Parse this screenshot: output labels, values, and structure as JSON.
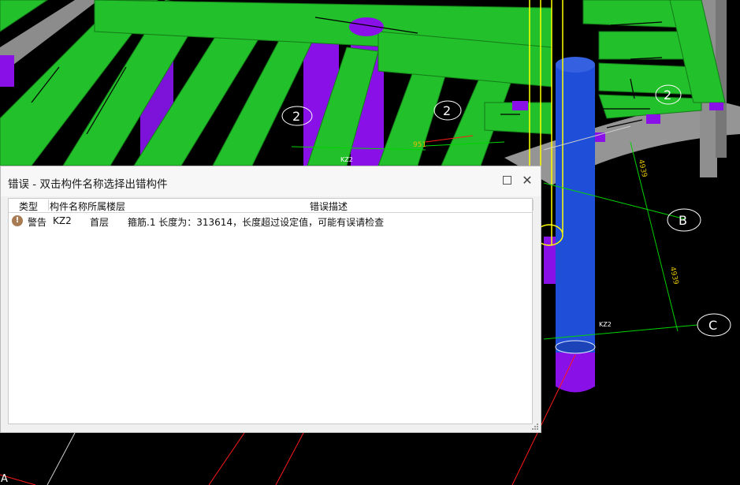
{
  "dialog": {
    "title": "错误 - 双击构件名称选择出错构件",
    "columns": {
      "type": "类型",
      "name_floor": "构件名称所属楼层",
      "description": "错误描述"
    },
    "rows": [
      {
        "type": "警告",
        "name": "KZ2",
        "floor": "首层",
        "description": "箍筋.1 长度为：313614，长度超过设定值，可能有误请检查"
      }
    ]
  },
  "scene": {
    "axis_labels": [
      "2",
      "2",
      "2",
      "B",
      "C",
      "A"
    ],
    "dimensions": [
      "951",
      "4939",
      "4939"
    ],
    "member_labels": [
      "KZ2",
      "KZ2"
    ]
  },
  "colors": {
    "beam": "#22c02a",
    "column_purple": "#8a10e8",
    "column_blue": "#1f4fd8",
    "slab": "#909090",
    "grid": "#00d400",
    "axis": "#ff2020"
  }
}
